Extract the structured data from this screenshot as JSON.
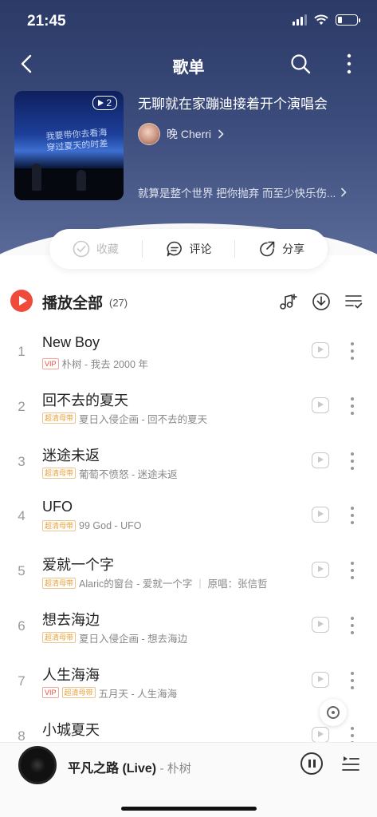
{
  "status_bar": {
    "time": "21:45"
  },
  "nav": {
    "title": "歌单"
  },
  "playlist": {
    "cover_count": "2",
    "cover_handwriting": [
      "我要带你去看海",
      "穿过夏天的时差"
    ],
    "title": "无聊就在家蹦迪接着开个演唱会",
    "creator": "晚 Cherri",
    "description": "就算是整个世界 把你抛弃 而至少快乐伤..."
  },
  "actions": {
    "collect": "收藏",
    "comment": "评论",
    "share": "分享"
  },
  "list_header": {
    "play_all": "播放全部",
    "count": "(27)"
  },
  "songs": [
    {
      "index": "1",
      "title": "New Boy",
      "vip": true,
      "hq": false,
      "artist_album": "朴树 - 我去 2000 年"
    },
    {
      "index": "2",
      "title": "回不去的夏天",
      "vip": false,
      "hq": true,
      "artist_album": "夏日入侵企画 - 回不去的夏天"
    },
    {
      "index": "3",
      "title": "迷途未返",
      "vip": false,
      "hq": true,
      "artist_album": "葡萄不愤怒 - 迷途未返"
    },
    {
      "index": "4",
      "title": "UFO",
      "vip": false,
      "hq": true,
      "artist_album": "99 God - UFO"
    },
    {
      "index": "5",
      "title": "爱就一个字",
      "vip": false,
      "hq": true,
      "artist_album": "Alaric的窗台 - 爱就一个字",
      "original": "原唱：张信哲"
    },
    {
      "index": "6",
      "title": "想去海边",
      "vip": false,
      "hq": true,
      "artist_album": "夏日入侵企画 - 想去海边"
    },
    {
      "index": "7",
      "title": "人生海海",
      "vip": true,
      "hq": true,
      "artist_album": "五月天 - 人生海海"
    },
    {
      "index": "8",
      "title": "小城夏天",
      "vip": false,
      "hq": false,
      "artist_album": ""
    }
  ],
  "tags": {
    "vip": "VIP",
    "hq": "超清母带"
  },
  "now_playing": {
    "title": "平凡之路 (Live)",
    "artist": "- 朴树"
  },
  "colors": {
    "accent": "#ef4a3a",
    "hero_bg": "#2b3a66"
  }
}
